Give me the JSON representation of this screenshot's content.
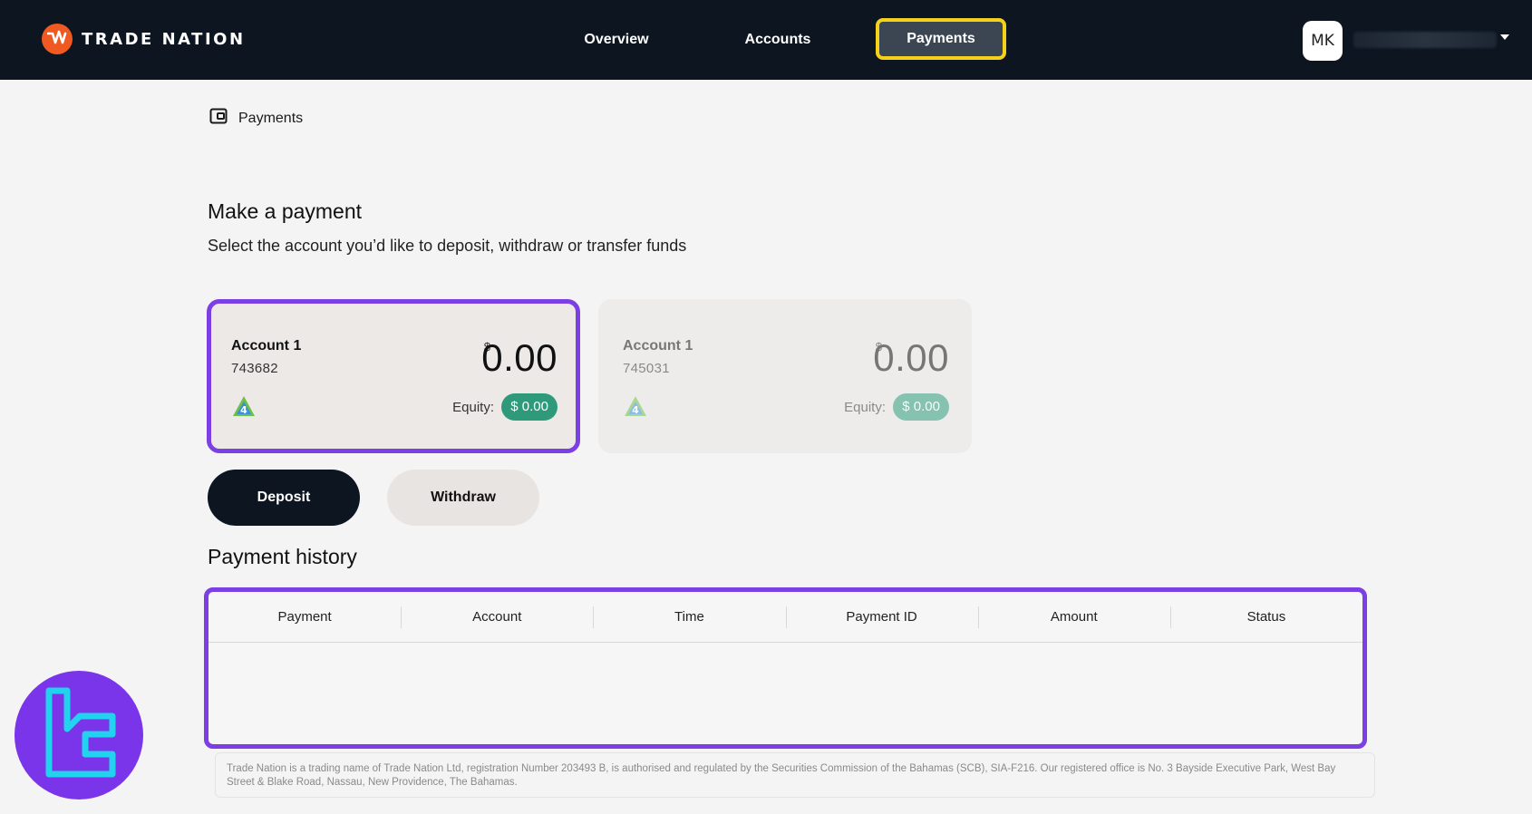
{
  "nav": {
    "brand": "TRADE NATION",
    "items": [
      "Overview",
      "Accounts",
      "Payments"
    ],
    "active": "Payments",
    "avatar_initials": "MK"
  },
  "breadcrumb": {
    "label": "Payments"
  },
  "make_payment": {
    "title": "Make a payment",
    "subtitle": "Select the account you’d like to deposit, withdraw or transfer funds"
  },
  "accounts": [
    {
      "name": "Account 1",
      "number": "743682",
      "currency_symbol": "$",
      "balance": "0.00",
      "equity_label": "Equity:",
      "equity": "$ 0.00",
      "selected": true
    },
    {
      "name": "Account 1",
      "number": "745031",
      "currency_symbol": "$",
      "balance": "0.00",
      "equity_label": "Equity:",
      "equity": "$ 0.00",
      "selected": false
    }
  ],
  "actions": {
    "deposit": "Deposit",
    "withdraw": "Withdraw"
  },
  "history": {
    "title": "Payment history",
    "columns": [
      "Payment",
      "Account",
      "Time",
      "Payment ID",
      "Amount",
      "Status"
    ]
  },
  "footer": {
    "disclaimer": "Trade Nation is a trading name of Trade Nation Ltd, registration Number 203493 B, is authorised and regulated by the Securities Commission of the Bahamas (SCB), SIA-F216. Our registered office is No. 3 Bayside Executive Park, West Bay Street & Blake Road, Nassau, New Providence, The Bahamas."
  },
  "colors": {
    "nav_bg": "#0c1520",
    "highlight_yellow": "#f5d21a",
    "highlight_purple": "#7b3fe4",
    "equity_green": "#2e9a7a",
    "brand_orange": "#f05a22"
  }
}
